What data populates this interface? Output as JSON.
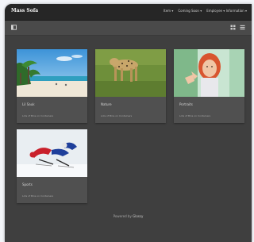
{
  "app": {
    "brand": "Mass Sofa"
  },
  "nav": {
    "items": [
      "Item ▾",
      "Coming Soon ▾",
      "Employee ▾ Information ▾"
    ]
  },
  "toolbar": {
    "left_icon": "sidebar-toggle-icon",
    "right_icons": [
      "grid-icon",
      "list-icon"
    ]
  },
  "albums": [
    {
      "title": "Lil Sauk",
      "meta": "Lots of Bins on Containers"
    },
    {
      "title": "Nature",
      "meta": "Lots of Bins on Containers"
    },
    {
      "title": "Portraits",
      "meta": "Lots of Bins on Containers"
    },
    {
      "title": "Sports",
      "meta": "Lots of Bins on Containers"
    }
  ],
  "footer": {
    "prefix": "Powered by",
    "link": "Glossy"
  },
  "colors": {
    "background": "#3f3f3f",
    "navbar": "#262626",
    "card": "#505050"
  }
}
